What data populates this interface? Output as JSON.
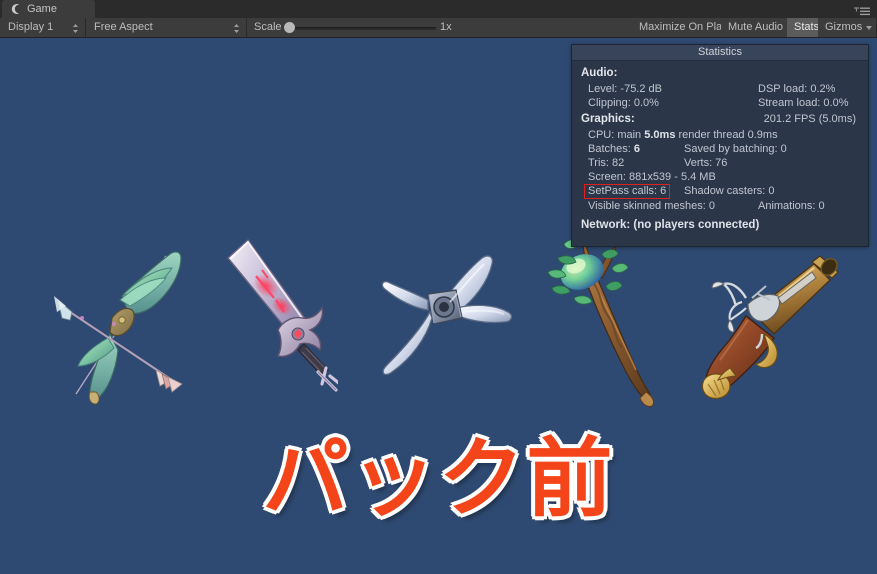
{
  "window": {
    "tab_label": "Game",
    "tab_icon": "unity-game-icon",
    "menu_icon": "tab-menu-icon"
  },
  "toolbar": {
    "display_dropdown": "Display 1",
    "aspect_dropdown": "Free Aspect",
    "scale_label": "Scale",
    "scale_value": "1x",
    "maximize_on_play": "Maximize On Play",
    "mute_audio": "Mute Audio",
    "stats": "Stats",
    "gizmos": "Gizmos",
    "gizmos_arrow_icon": "chevron-down-icon",
    "stats_active": true
  },
  "game": {
    "background_color": "#2f4a72",
    "caption_text": "パック前",
    "caption_color": "#f4451a",
    "caption_outline_color": "#ffffff",
    "sprites": [
      {
        "name": "winged-bow-and-arrow",
        "label": "Bow"
      },
      {
        "name": "broadsword",
        "label": "Sword"
      },
      {
        "name": "four-blade-shuriken",
        "label": "Shuriken"
      },
      {
        "name": "nature-staff",
        "label": "Staff"
      },
      {
        "name": "flintlock-pistol",
        "label": "Pistol"
      }
    ]
  },
  "statistics": {
    "title": "Statistics",
    "audio": {
      "heading": "Audio:",
      "level": "Level: -75.2 dB",
      "dsp_load": "DSP load: 0.2%",
      "clipping": "Clipping: 0.0%",
      "stream_load": "Stream load: 0.0%"
    },
    "graphics": {
      "heading": "Graphics:",
      "fps": "201.2 FPS (5.0ms)",
      "cpu_prefix": "CPU: main ",
      "cpu_main": "5.0ms",
      "cpu_suffix": " render thread 0.9ms",
      "batches_label": "Batches: ",
      "batches_value": "6",
      "saved_by_batching": "Saved by batching: 0",
      "tris": "Tris: 82",
      "verts": "Verts: 76",
      "screen": "Screen: 881x539 - 5.4 MB",
      "setpass_calls": "SetPass calls: 6",
      "shadow_casters": "Shadow casters: 0",
      "visible_skinned_meshes": "Visible skinned meshes: 0",
      "animations": "Animations: 0",
      "highlight_color": "#e02020"
    },
    "network": {
      "heading": "Network: (no players connected)"
    }
  }
}
